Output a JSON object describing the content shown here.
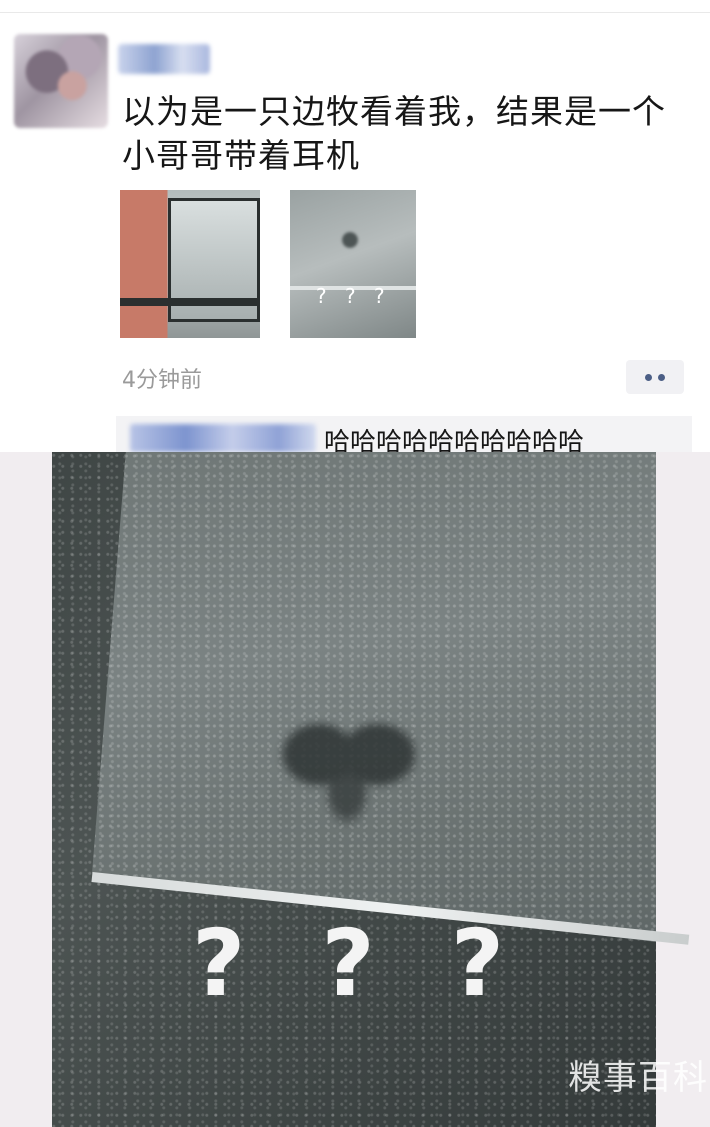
{
  "post": {
    "text": "以为是一只边牧看着我，结果是一个小哥哥带着耳机",
    "time": "4分钟前"
  },
  "thumbnail2": {
    "overlay_text": "? ? ?"
  },
  "comment": {
    "text": "哈哈哈哈哈哈哈哈哈哈"
  },
  "photo": {
    "overlay_text": "? ? ?",
    "watermark": "糗事百科"
  },
  "icons": {
    "more": "more-dots-icon"
  },
  "colors": {
    "link_blue": "#4c5f86",
    "time_gray": "#9a9a9a",
    "comment_bg": "#f3f3f5"
  }
}
